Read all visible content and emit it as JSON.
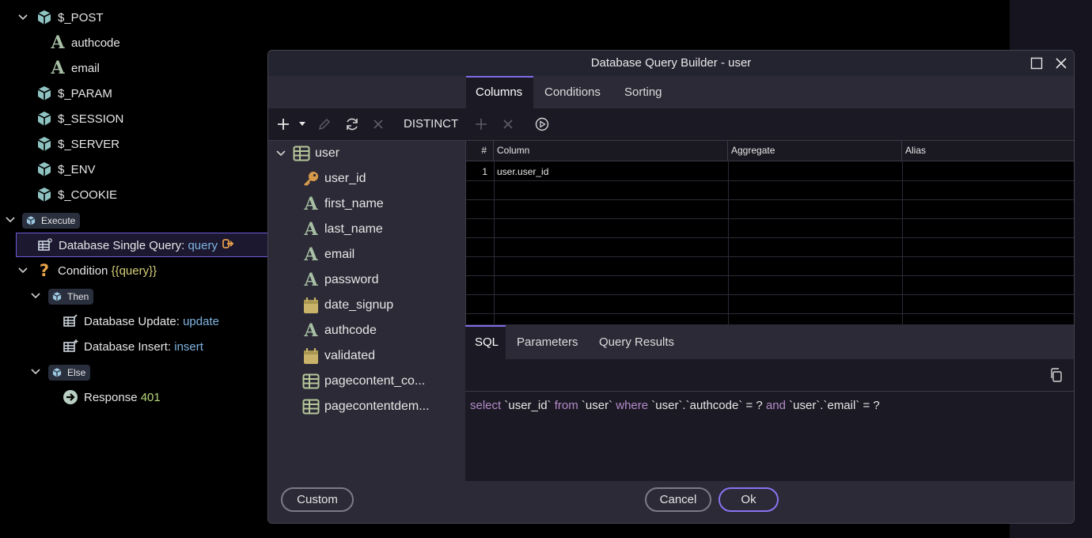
{
  "tree": {
    "post": "$_POST",
    "authcode": "authcode",
    "email": "email",
    "param": "$_PARAM",
    "session": "$_SESSION",
    "server": "$_SERVER",
    "env": "$_ENV",
    "cookie": "$_COOKIE",
    "execute": "Execute",
    "single_query_label": "Database Single Query:",
    "single_query_name": "query",
    "condition_label": "Condition",
    "condition_expr": "{{query}}",
    "then": "Then",
    "update_label": "Database Update:",
    "update_name": "update",
    "insert_label": "Database Insert:",
    "insert_name": "insert",
    "else": "Else",
    "response_label": "Response",
    "response_code": "401"
  },
  "dialog": {
    "title": "Database Query Builder - user",
    "tabs": [
      "Columns",
      "Conditions",
      "Sorting"
    ],
    "distinct_label": "DISTINCT",
    "table_name": "user",
    "fields": [
      {
        "name": "user_id",
        "icon": "key-icon"
      },
      {
        "name": "first_name",
        "icon": "text-field-icon"
      },
      {
        "name": "last_name",
        "icon": "text-field-icon"
      },
      {
        "name": "email",
        "icon": "text-field-icon"
      },
      {
        "name": "password",
        "icon": "text-field-icon"
      },
      {
        "name": "date_signup",
        "icon": "calendar-icon"
      },
      {
        "name": "authcode",
        "icon": "text-field-icon"
      },
      {
        "name": "validated",
        "icon": "calendar-icon"
      },
      {
        "name": "pagecontent_co...",
        "icon": "table-icon"
      },
      {
        "name": "pagecontentdem...",
        "icon": "table-icon"
      }
    ],
    "grid": {
      "headers": [
        "#",
        "Column",
        "Aggregate",
        "Alias"
      ],
      "rows": [
        [
          "1",
          "user.user_id",
          "",
          ""
        ]
      ]
    },
    "bottom_tabs": [
      "SQL",
      "Parameters",
      "Query Results"
    ],
    "sql": {
      "p1": "select",
      "p2": "`user_id`",
      "p3": "from",
      "p4": "`user`",
      "p5": "where",
      "p6": "`user`.`authcode` = ?",
      "p7": "and",
      "p8": "`user`.`email` = ?"
    },
    "buttons": {
      "custom": "Custom",
      "cancel": "Cancel",
      "ok": "Ok"
    }
  },
  "colors": {
    "accent": "#7f6be6",
    "cube": "#8fc3c2",
    "field_icon": "#a7bfa4",
    "key": "#d89a4a",
    "calendar": "#c9b36a",
    "keyword": "#b48ac9"
  }
}
